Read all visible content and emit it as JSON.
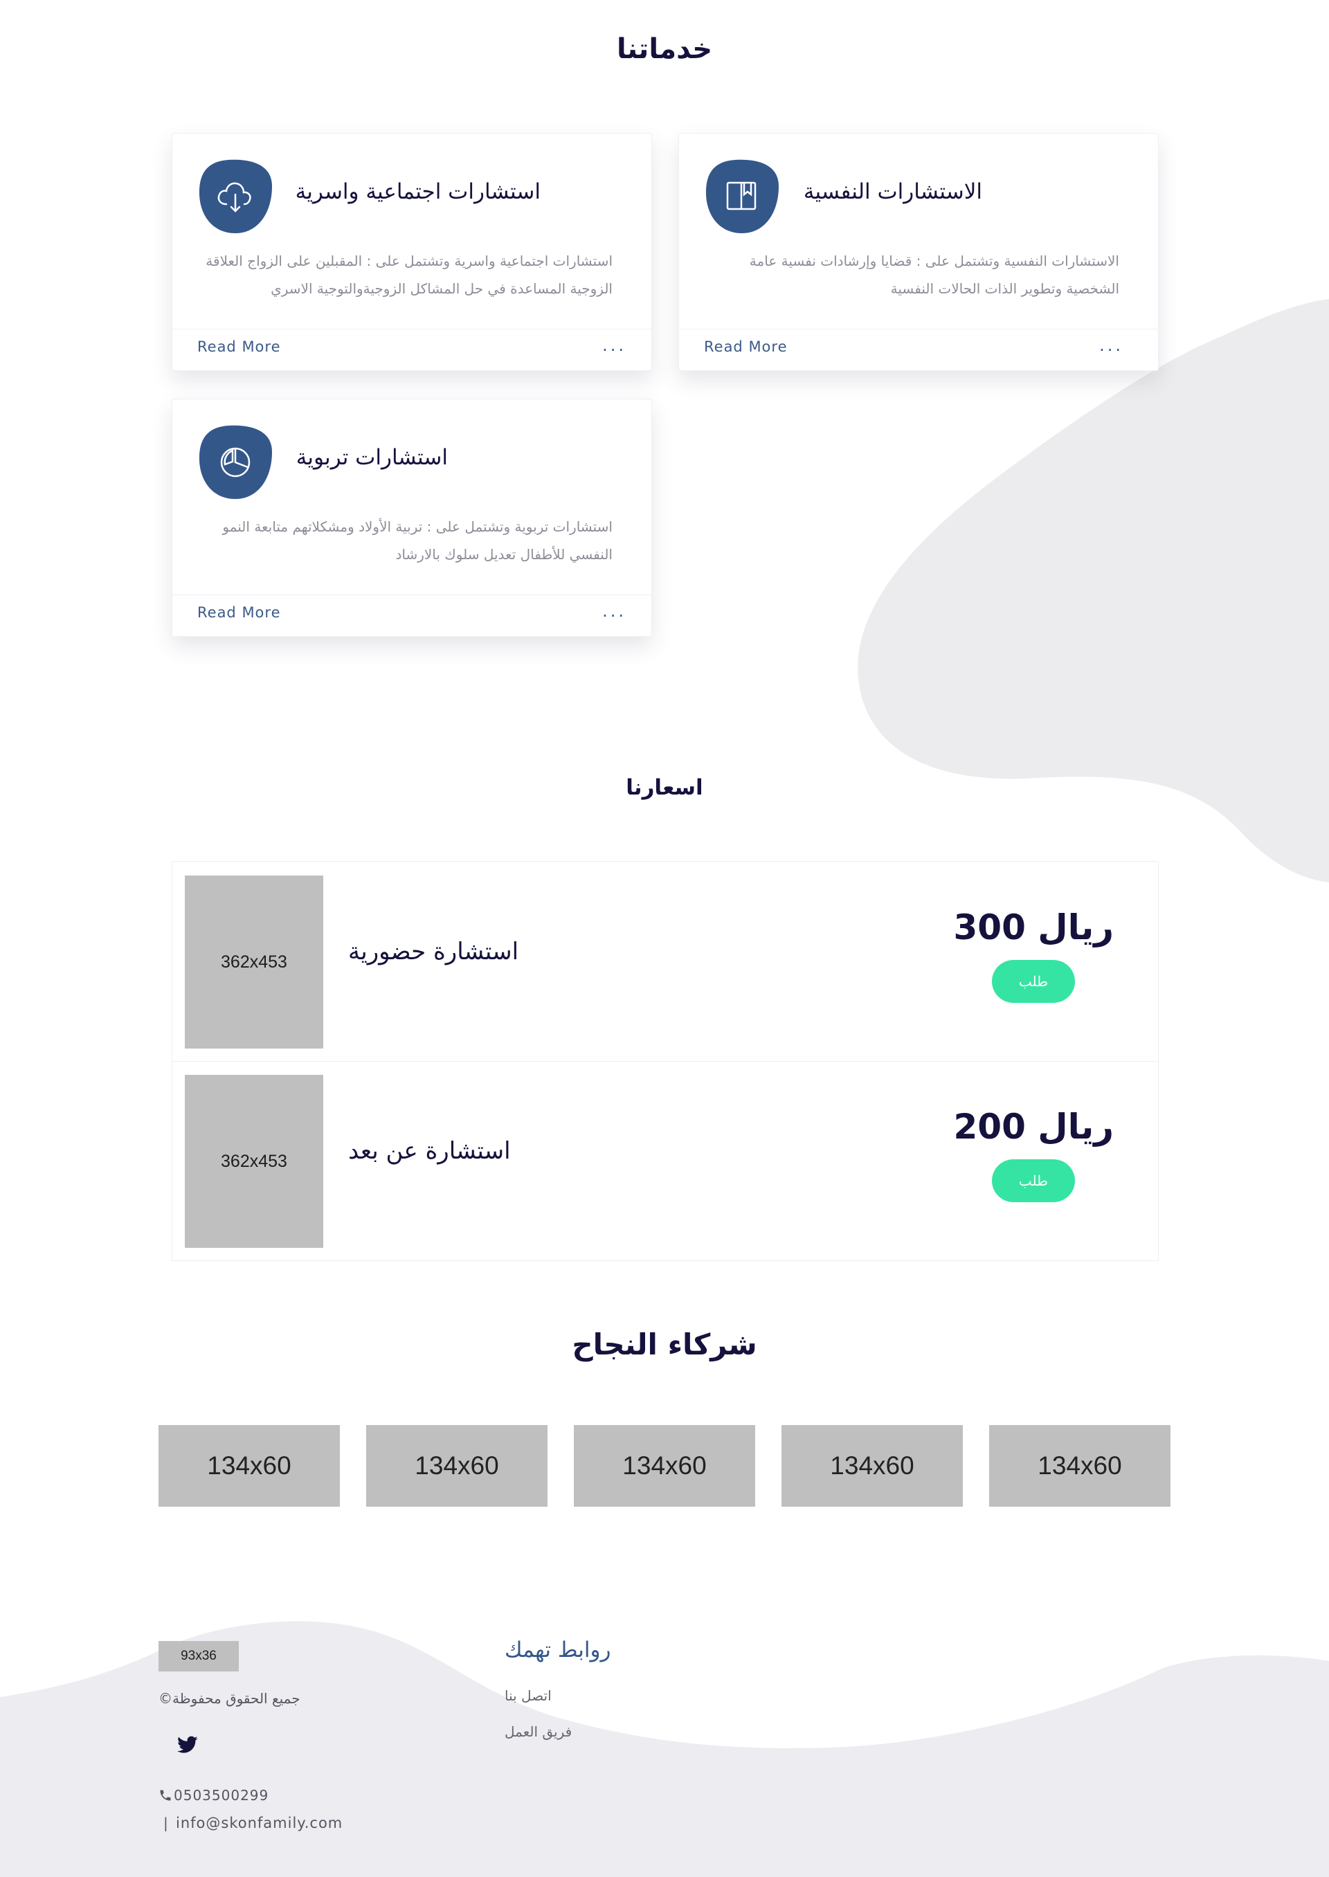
{
  "colors": {
    "primary": "#15123d",
    "icon_blob": "#34578a",
    "accent_green": "#35e4a3",
    "muted_text": "#8d8d98",
    "read_more": "#3a5a88",
    "background_shape": "#ececee",
    "footer_wave": "#ececf1",
    "placeholder": "#bfbfbf"
  },
  "services": {
    "title": "خدماتنا",
    "cards": [
      {
        "title": "الاستشارات النفسية",
        "icon": "book-icon",
        "description": "الاستشارات النفسية وتشتمل على : قضايا وإرشادات نفسية عامة الشخصية وتطوير الذات الحالات النفسية",
        "read_more": "Read More",
        "dots": "..."
      },
      {
        "title": "استشارات اجتماعية واسرية",
        "icon": "cloud-download-icon",
        "description": "استشارات اجتماعية واسرية وتشتمل على : المقبلين على الزواج العلاقة الزوجية المساعدة في حل المشاكل الزوجيةوالتوجية الاسري",
        "read_more": "Read More",
        "dots": "..."
      },
      {
        "title": "استشارات تربوية",
        "icon": "pie-chart-icon",
        "description": "استشارات تربوية وتشتمل على : تربية الأولاد ومشكلاتهم متابعة النمو النفسي للأطفال تعديل سلوك بالارشاد",
        "read_more": "Read More",
        "dots": "..."
      }
    ]
  },
  "pricing": {
    "title": "اسعارنا",
    "items": [
      {
        "image_label": "362x453",
        "name": "استشارة حضورية",
        "price": "ريال 300",
        "button": "طلب"
      },
      {
        "image_label": "362x453",
        "name": "استشارة عن بعد",
        "price": "ريال 200",
        "button": "طلب"
      }
    ]
  },
  "partners": {
    "title": "شركاء النجاح",
    "logos": [
      "134x60",
      "134x60",
      "134x60",
      "134x60",
      "134x60"
    ]
  },
  "footer": {
    "logo_label": "93x36",
    "copyright": "جميع الحقوق محفوظة©",
    "social_icon": "twitter-icon",
    "phone_icon": "phone-icon",
    "phone": "0503500299",
    "email_separator": "|",
    "email": "info@skonfamily.com",
    "links_title": "روابط تهمك",
    "links": [
      "اتصل بنا",
      "فريق العمل"
    ]
  }
}
